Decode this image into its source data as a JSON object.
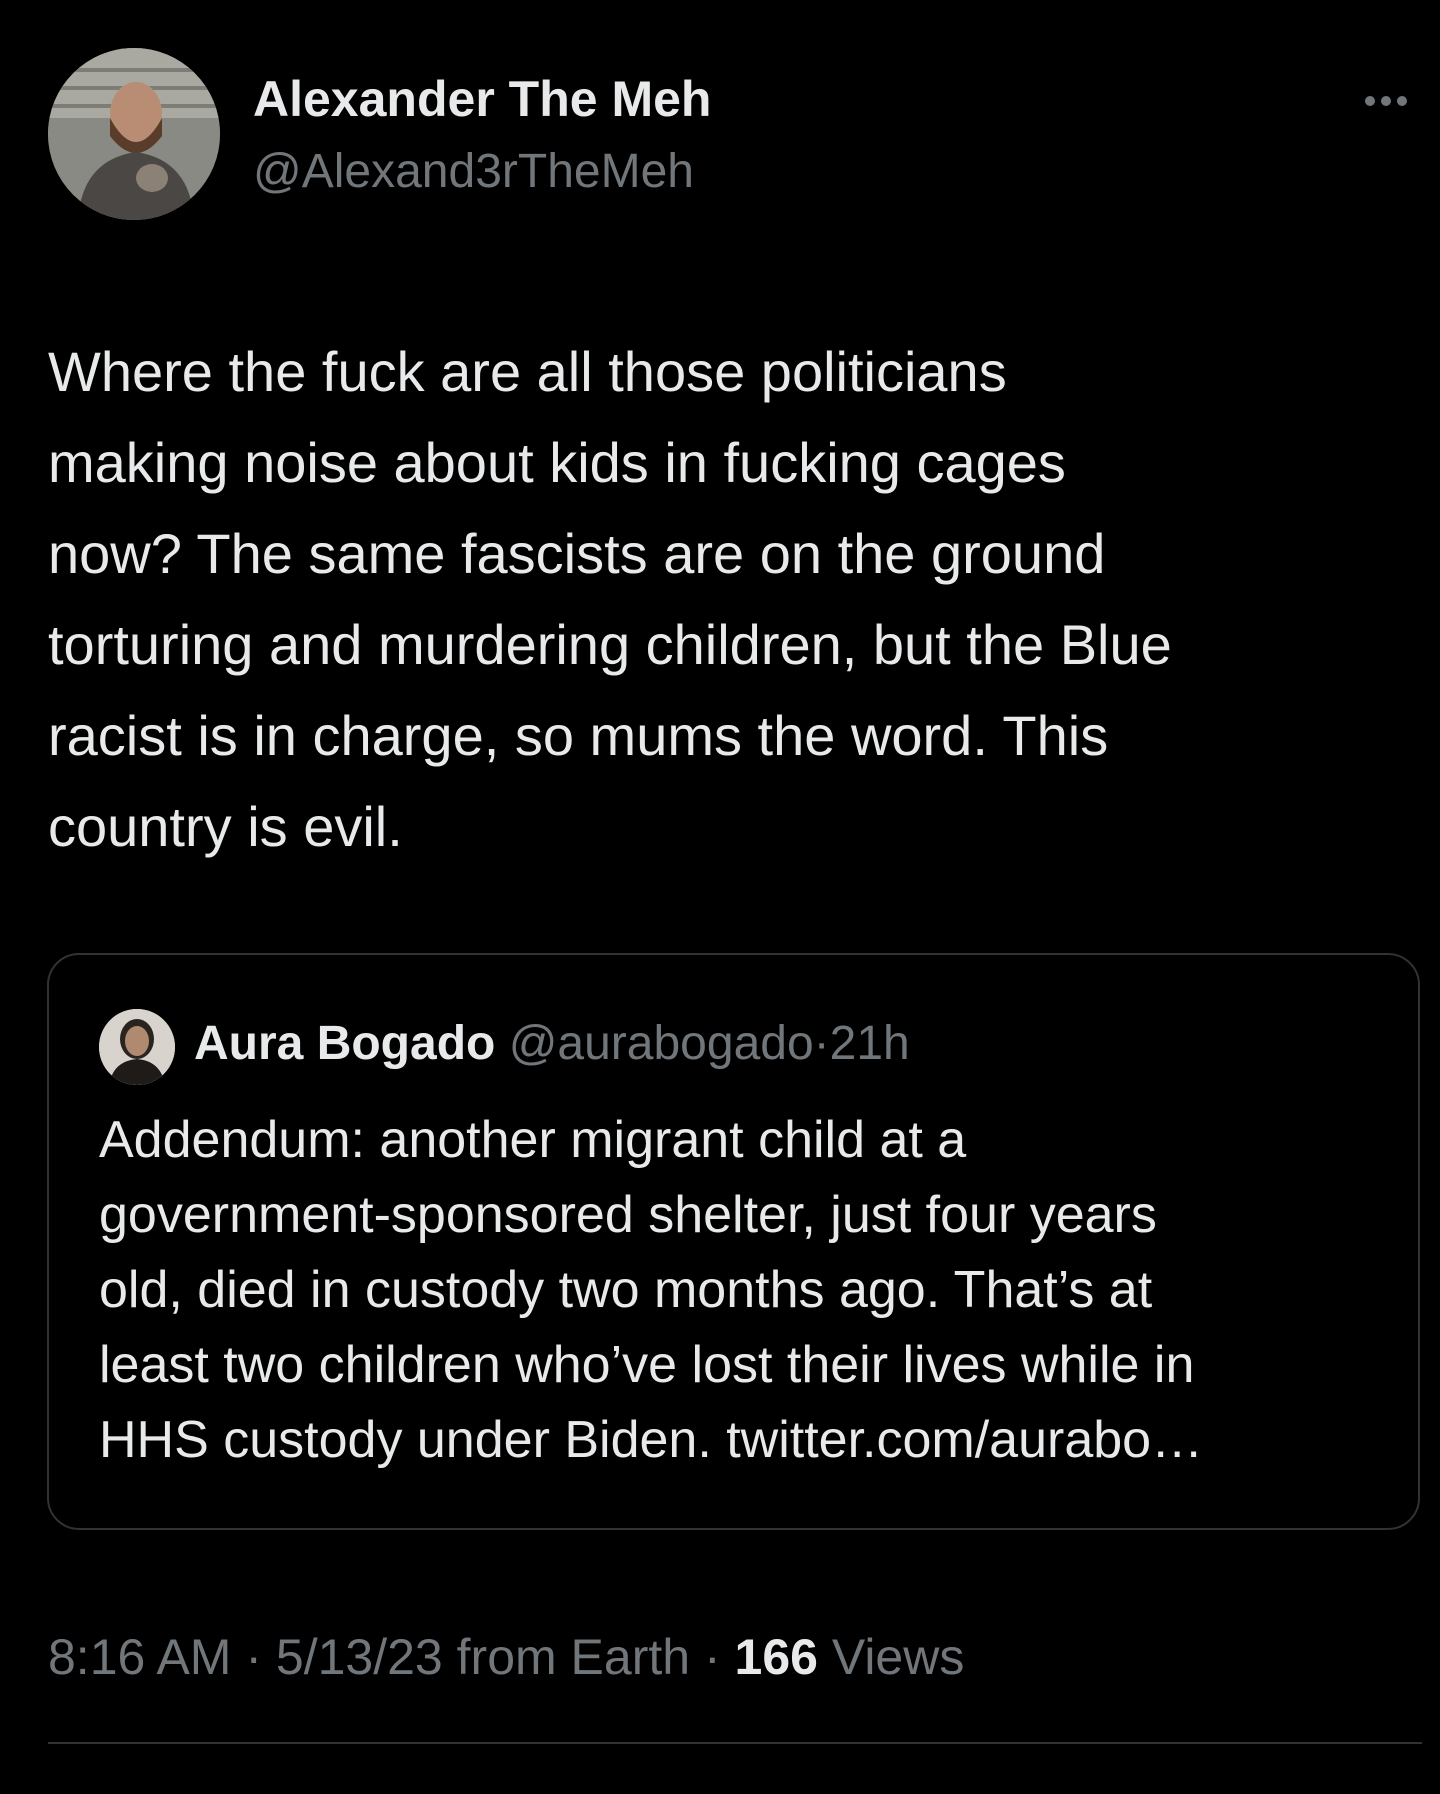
{
  "author": {
    "display_name": "Alexander The Meh",
    "handle": "@Alexand3rTheMeh"
  },
  "menu": {
    "more_icon": "more-horizontal-icon"
  },
  "tweet": {
    "text": "Where the fuck are all those politicians\nmaking noise about kids in fucking cages\nnow? The same fascists are on the ground\ntorturing and murdering children, but the Blue\nracist is in charge, so mums the word. This\ncountry is evil."
  },
  "quote": {
    "display_name": "Aura Bogado",
    "handle": "@aurabogado",
    "separator": "·",
    "time": "21h",
    "text": "Addendum: another migrant child at a\ngovernment-sponsored shelter, just four years\nold, died in custody two months ago. That’s at\nleast two children who’ve lost their lives while in\nHHS custody under Biden. twitter.com/aurabo…"
  },
  "meta": {
    "time": "8:16 AM",
    "separator": "·",
    "date": "5/13/23",
    "source": "from Earth",
    "views_count": "166",
    "views_label": "Views"
  },
  "colors": {
    "background": "#000000",
    "primary_text": "#e7e9ea",
    "secondary_text": "#71767b",
    "border": "#2f3336"
  }
}
